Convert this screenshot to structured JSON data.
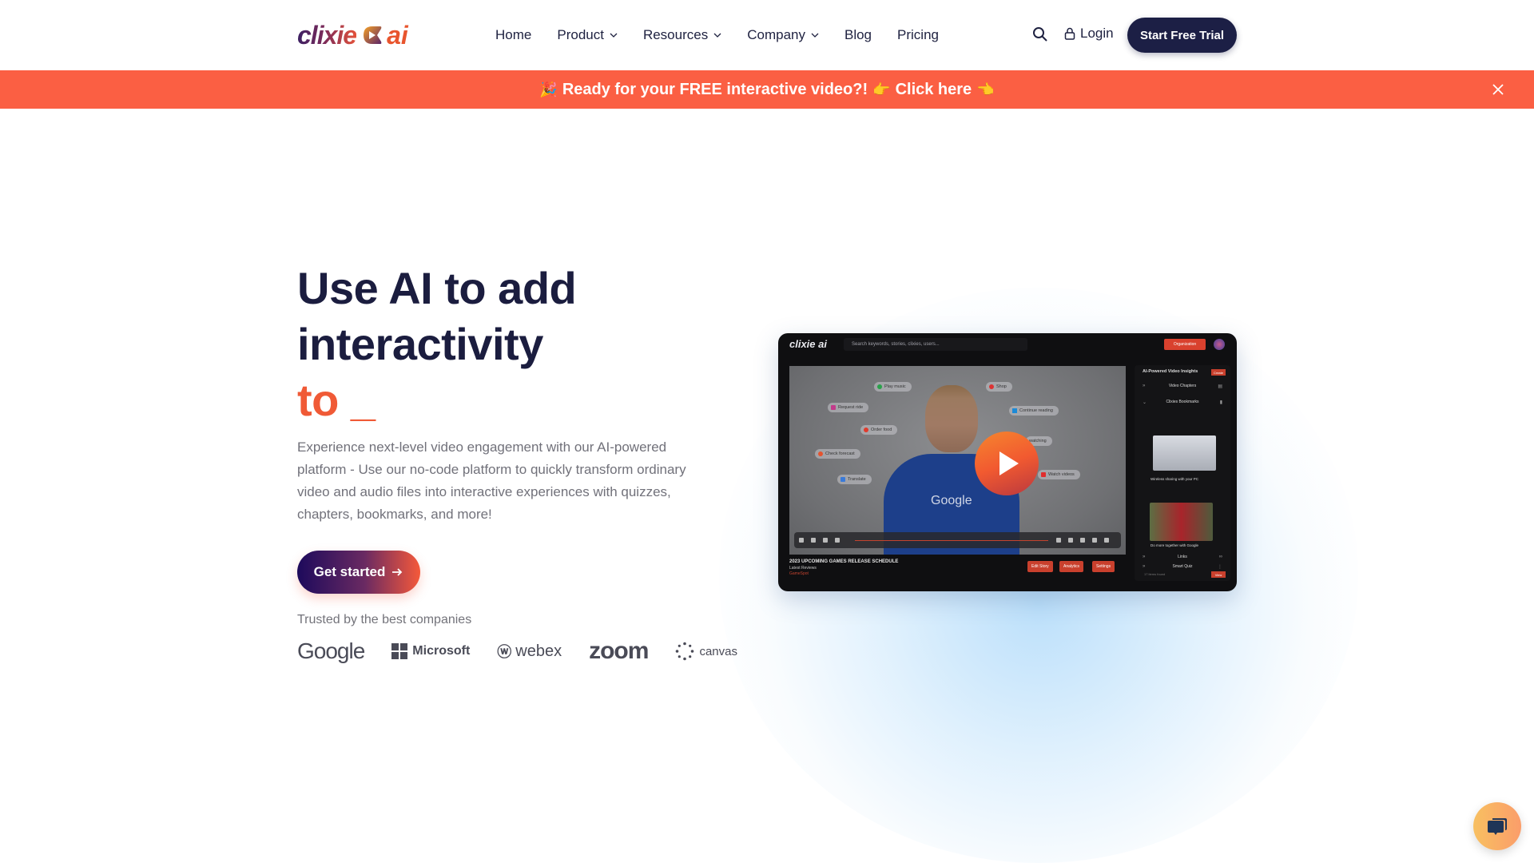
{
  "header": {
    "logo_text": "clixie",
    "logo_suffix": "ai",
    "nav": [
      {
        "label": "Home",
        "dropdown": false
      },
      {
        "label": "Product",
        "dropdown": true
      },
      {
        "label": "Resources",
        "dropdown": true
      },
      {
        "label": "Company",
        "dropdown": true
      },
      {
        "label": "Blog",
        "dropdown": false
      },
      {
        "label": "Pricing",
        "dropdown": false
      }
    ],
    "search_icon": "search-icon",
    "login_label": "Login",
    "trial_label": "Start Free Trial"
  },
  "banner": {
    "emoji_start": "🎉",
    "text": "Ready for your FREE interactive video?!",
    "emoji_mid": "👉",
    "link_text": "Click here",
    "emoji_end": "👈",
    "bg_color": "#fb5f43"
  },
  "hero": {
    "title_line1": "Use AI to add",
    "title_line2": "interactivity",
    "title_line3": "to _",
    "description": "Experience next-level video engagement with our AI-powered platform - Use our no-code platform to quickly transform ordinary video and audio files into interactive experiences with quizzes, chapters, bookmarks, and more!",
    "cta_label": "Get started",
    "trusted_label": "Trusted by the best companies",
    "companies": [
      "Google",
      "Microsoft",
      "webex",
      "zoom",
      "canvas"
    ],
    "accent_color": "#f05a36"
  },
  "app_preview": {
    "logo": "clixie ai",
    "search_placeholder": "Search keywords, stories, clixies, users...",
    "org_label": "Organization",
    "chips": [
      "Play music",
      "Shop",
      "Request ride",
      "Continue reading",
      "Order food",
      "watching",
      "Check forecast",
      "Watch videos",
      "Translate"
    ],
    "shirt_brand": "Google",
    "video_title": "2023 UPCOMING GAMES RELEASE SCHEDULE",
    "video_subtitle": "Latest Reviews",
    "video_source": "GameSpot",
    "buttons": [
      "Edit Story",
      "Analytics",
      "Settings"
    ],
    "sidebar": {
      "heading": "AI-Powered Video Insights",
      "create_label": "Create",
      "rows": [
        "Video Chapters",
        "Clixies Bookmarks",
        "Links",
        "Smart Quiz"
      ],
      "bookmark1_caption": "Wireless sharing with your PC",
      "bookmark2_caption": "Do more together with Google",
      "found_label": "17 items found",
      "view_label": "View"
    }
  }
}
